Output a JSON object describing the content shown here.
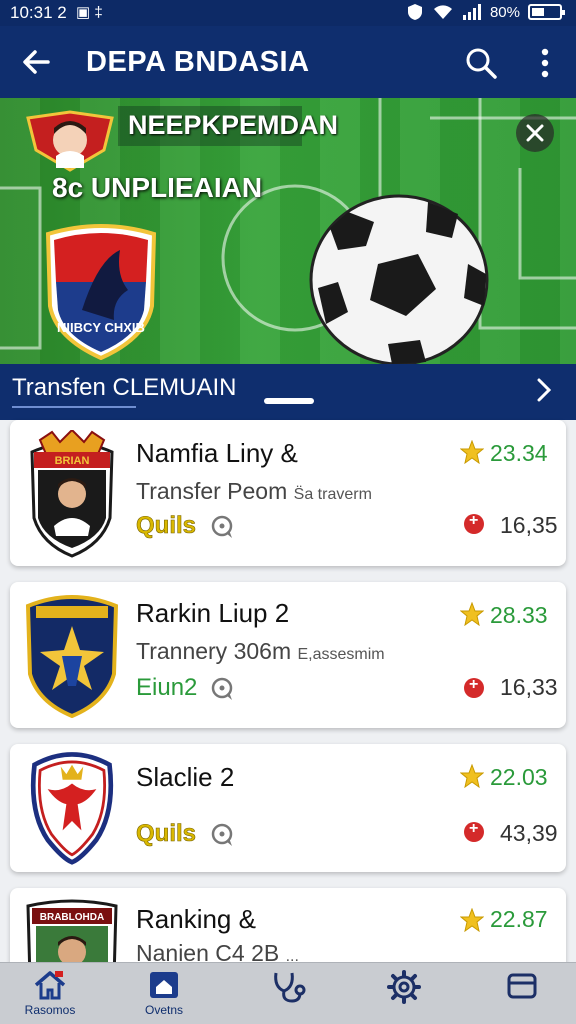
{
  "status_bar": {
    "time": "10:31 2",
    "left_icons": "▣ ‡",
    "battery": "80%"
  },
  "app_bar": {
    "title": "DEPA BNDASIA"
  },
  "banner": {
    "headline": "NEEPKPEMDAN",
    "subhead": "8c UNPLIEAIAN",
    "crest_text": "NIIBCY CHXIB"
  },
  "section": {
    "title": "Transfen CLEMUAIN"
  },
  "cards": [
    {
      "name": "Namfia Liny &",
      "desc": "Transfer Peom",
      "desc_small": "S̈a traverm",
      "tag": "Quils",
      "tag_color": "yellow",
      "rating": "23.34",
      "count": "16,35",
      "logo_text": "BRIAN"
    },
    {
      "name": "Rarkin Liup 2",
      "desc": "Trannery 306m",
      "desc_small": "E,assesmim",
      "tag": "Eiun2",
      "tag_color": "green",
      "rating": "28.33",
      "count": "16,33"
    },
    {
      "name": "Slaclie 2",
      "desc": "",
      "desc_small": "",
      "tag": "Quils",
      "tag_color": "yellow",
      "rating": "22.03",
      "count": "43,39"
    },
    {
      "name": "Ranking &",
      "desc": "Nanien C4 2B",
      "desc_small": "...",
      "tag": "",
      "tag_color": "",
      "rating": "22.87",
      "count": "",
      "logo_text": "BRABLOHDA"
    }
  ],
  "bottom_nav": [
    {
      "label": "Rasomos",
      "icon": "home-icon"
    },
    {
      "label": "Ovetns",
      "icon": "house-icon"
    },
    {
      "label": "",
      "icon": "stethoscope-icon"
    },
    {
      "label": "",
      "icon": "gear-icon"
    },
    {
      "label": "",
      "icon": "wallet-icon"
    }
  ],
  "colors": {
    "primary": "#0f2e6e",
    "rating_green": "#2a9a3a",
    "alert_red": "#d42a2a",
    "star_gold": "#f0c020"
  }
}
